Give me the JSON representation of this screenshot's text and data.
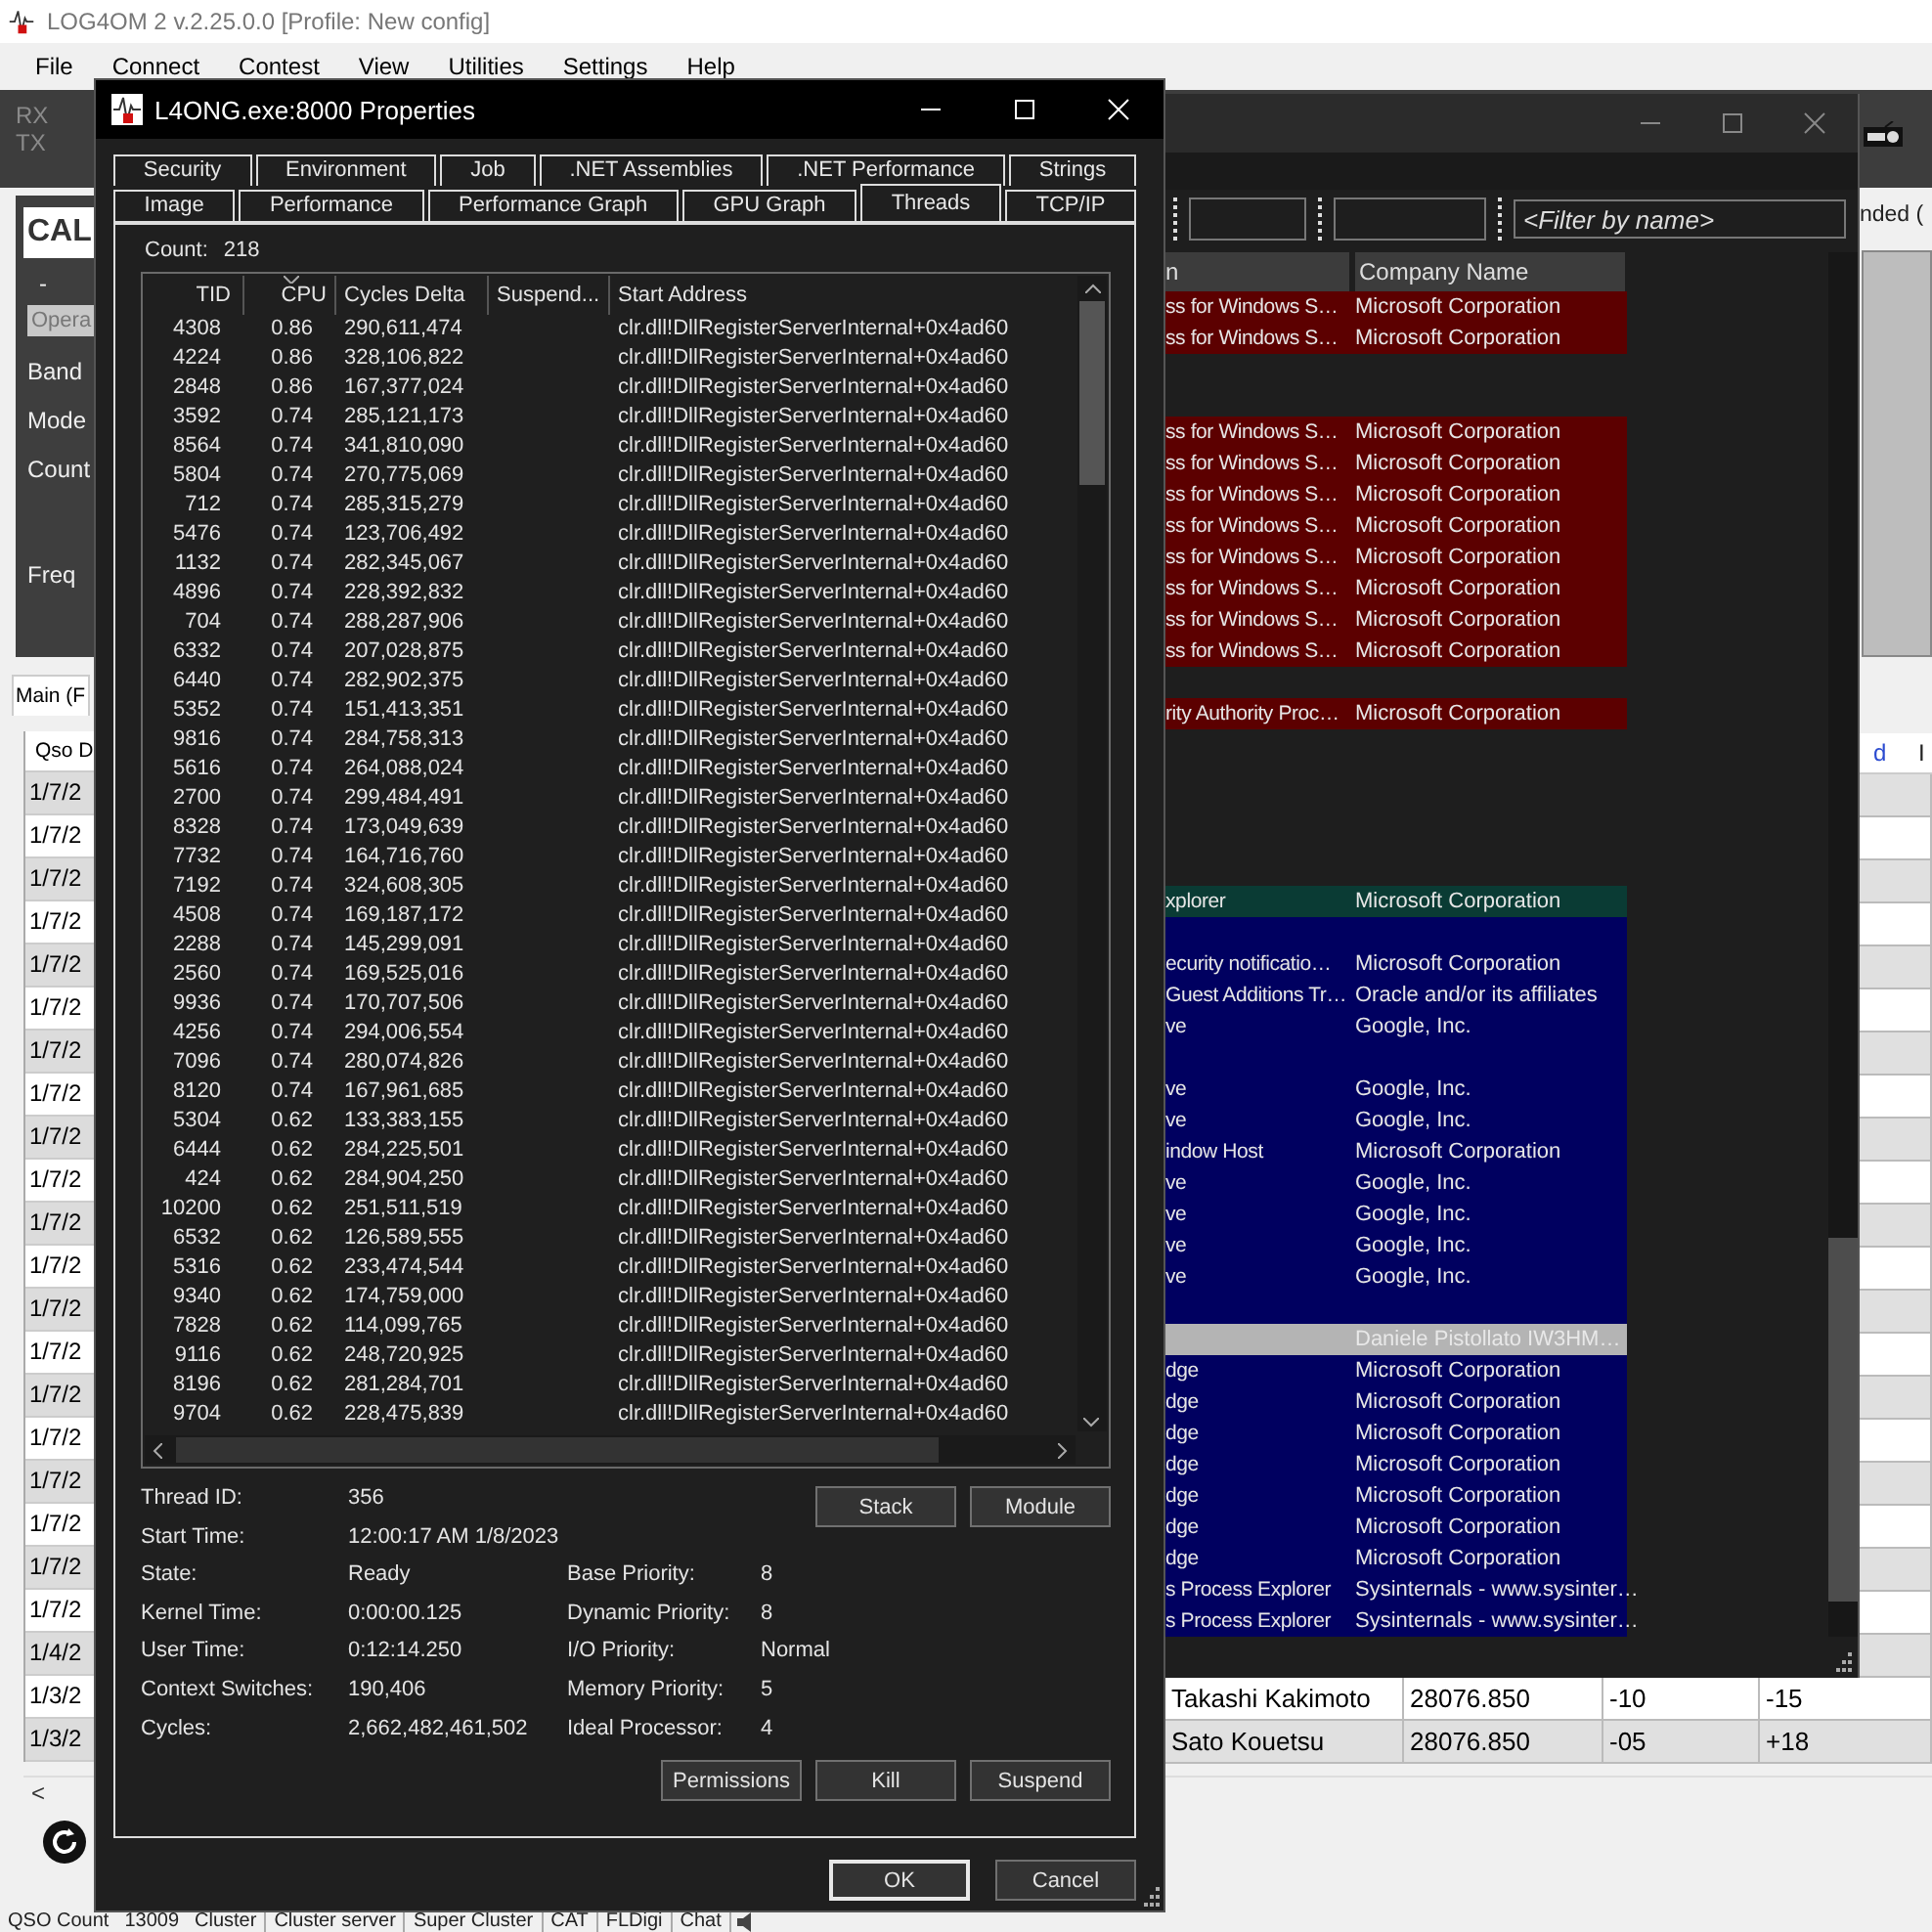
{
  "main_window": {
    "title": "LOG4OM 2 v.2.25.0.0 [Profile: New config]",
    "menu": [
      "File",
      "Connect",
      "Contest",
      "View",
      "Utilities",
      "Settings",
      "Help"
    ],
    "toolbar_labels": [
      "RX",
      "TX"
    ],
    "callsign_label": "CAL",
    "dash": "-",
    "operator_field": "Opera",
    "panel_labels": [
      "Band",
      "Mode",
      "Count"
    ],
    "freq_label": "Freq",
    "tab": "Main (F",
    "filter_text": "nded (",
    "table": {
      "column": "Qso D",
      "right_headers": [
        "d",
        "I"
      ],
      "dates": [
        "1/7/2",
        "1/7/2",
        "1/7/2",
        "1/7/2",
        "1/7/2",
        "1/7/2",
        "1/7/2",
        "1/7/2",
        "1/7/2",
        "1/7/2",
        "1/7/2",
        "1/7/2",
        "1/7/2",
        "1/7/2",
        "1/7/2",
        "1/7/2",
        "1/7/2",
        "1/7/2",
        "1/7/2",
        "1/7/2",
        "1/4/2",
        "1/3/2",
        "1/3/2"
      ],
      "bottom_rows": [
        {
          "name": "Takashi Kakimoto",
          "frequency": "28076.850",
          "column_3": "-10",
          "column_4": "-15"
        },
        {
          "name": "Sato Kouetsu",
          "frequency": "28076.850",
          "column_3": "-05",
          "column_4": "+18"
        }
      ],
      "scroll_left": "<"
    },
    "status_bar": [
      "QSO Count",
      "13009",
      "Cluster",
      "Cluster server",
      "Super Cluster",
      "CAT",
      "FLDigi",
      "Chat"
    ]
  },
  "process_explorer": {
    "filter": {
      "placeholder": "<Filter by name>"
    },
    "columns": [
      "n",
      "Company Name"
    ],
    "rows": [
      {
        "description": "ss for Windows S…",
        "company": "Microsoft Corporation",
        "color": "#5c0000"
      },
      {
        "description": "ss for Windows S…",
        "company": "Microsoft Corporation",
        "color": "#5c0000"
      },
      {
        "color": "#1e1e1e"
      },
      {
        "color": "#1e1e1e"
      },
      {
        "description": "ss for Windows S…",
        "company": "Microsoft Corporation",
        "color": "#5c0000"
      },
      {
        "description": "ss for Windows S…",
        "company": "Microsoft Corporation",
        "color": "#5c0000"
      },
      {
        "description": "ss for Windows S…",
        "company": "Microsoft Corporation",
        "color": "#5c0000"
      },
      {
        "description": "ss for Windows S…",
        "company": "Microsoft Corporation",
        "color": "#5c0000"
      },
      {
        "description": "ss for Windows S…",
        "company": "Microsoft Corporation",
        "color": "#5c0000"
      },
      {
        "description": "ss for Windows S…",
        "company": "Microsoft Corporation",
        "color": "#5c0000"
      },
      {
        "description": "ss for Windows S…",
        "company": "Microsoft Corporation",
        "color": "#5c0000"
      },
      {
        "description": "ss for Windows S…",
        "company": "Microsoft Corporation",
        "color": "#5c0000"
      },
      {
        "color": "#1e1e1e"
      },
      {
        "description": "rity Authority Proc…",
        "company": "Microsoft Corporation",
        "color": "#5c0000"
      },
      {
        "color": "#1e1e1e"
      },
      {
        "color": "#1e1e1e"
      },
      {
        "color": "#1e1e1e"
      },
      {
        "color": "#1e1e1e"
      },
      {
        "color": "#1e1e1e"
      },
      {
        "description": "xplorer",
        "company": "Microsoft Corporation",
        "color": "#0a3b34"
      },
      {
        "color": "#000060"
      },
      {
        "description": "ecurity notificatio…",
        "company": "Microsoft Corporation",
        "color": "#000060"
      },
      {
        "description": "Guest Additions Tr…",
        "company": "Oracle and/or its affiliates",
        "color": "#000060"
      },
      {
        "description": "ve",
        "company": "Google, Inc.",
        "color": "#000060"
      },
      {
        "color": "#000060"
      },
      {
        "description": "ve",
        "company": "Google, Inc.",
        "color": "#000060"
      },
      {
        "description": "ve",
        "company": "Google, Inc.",
        "color": "#000060"
      },
      {
        "description": "indow Host",
        "company": "Microsoft Corporation",
        "color": "#000060"
      },
      {
        "description": "ve",
        "company": "Google, Inc.",
        "color": "#000060"
      },
      {
        "description": "ve",
        "company": "Google, Inc.",
        "color": "#000060"
      },
      {
        "description": "ve",
        "company": "Google, Inc.",
        "color": "#000060"
      },
      {
        "description": "ve",
        "company": "Google, Inc.",
        "color": "#000060"
      },
      {
        "color": "#000060"
      },
      {
        "company": "Daniele Pistollato IW3HM…",
        "color": "#b4b4b4"
      },
      {
        "description": "dge",
        "company": "Microsoft Corporation",
        "color": "#000060"
      },
      {
        "description": "dge",
        "company": "Microsoft Corporation",
        "color": "#000060"
      },
      {
        "description": "dge",
        "company": "Microsoft Corporation",
        "color": "#000060"
      },
      {
        "description": "dge",
        "company": "Microsoft Corporation",
        "color": "#000060"
      },
      {
        "description": "dge",
        "company": "Microsoft Corporation",
        "color": "#000060"
      },
      {
        "description": "dge",
        "company": "Microsoft Corporation",
        "color": "#000060"
      },
      {
        "description": "dge",
        "company": "Microsoft Corporation",
        "color": "#000060"
      },
      {
        "description": "s Process Explorer",
        "company": "Sysinternals - www.sysinter…",
        "color": "#000060"
      },
      {
        "description": "s Process Explorer",
        "company": "Sysinternals - www.sysinter…",
        "color": "#000060"
      }
    ]
  },
  "properties": {
    "title": "L4ONG.exe:8000 Properties",
    "tab_rows": [
      [
        {
          "label": "Security",
          "selected": false
        },
        {
          "label": "Environment",
          "selected": false
        },
        {
          "label": "Job",
          "selected": false
        },
        {
          "label": ".NET Assemblies",
          "selected": false
        },
        {
          "label": ".NET Performance",
          "selected": false
        },
        {
          "label": "Strings",
          "selected": false
        }
      ],
      [
        {
          "label": "Image",
          "selected": false
        },
        {
          "label": "Performance",
          "selected": false
        },
        {
          "label": "Performance Graph",
          "selected": false
        },
        {
          "label": "GPU Graph",
          "selected": false
        },
        {
          "label": "Threads",
          "selected": true
        },
        {
          "label": "TCP/IP",
          "selected": false
        }
      ]
    ],
    "count_label": "Count:",
    "count": "218",
    "columns": [
      "TID",
      "CPU",
      "Cycles Delta",
      "Suspend...",
      "Start Address"
    ],
    "threads": [
      [
        "4308",
        "0.86",
        "290,611,474",
        "clr.dll!DllRegisterServerInternal+0x4ad60"
      ],
      [
        "4224",
        "0.86",
        "328,106,822",
        "clr.dll!DllRegisterServerInternal+0x4ad60"
      ],
      [
        "2848",
        "0.86",
        "167,377,024",
        "clr.dll!DllRegisterServerInternal+0x4ad60"
      ],
      [
        "3592",
        "0.74",
        "285,121,173",
        "clr.dll!DllRegisterServerInternal+0x4ad60"
      ],
      [
        "8564",
        "0.74",
        "341,810,090",
        "clr.dll!DllRegisterServerInternal+0x4ad60"
      ],
      [
        "5804",
        "0.74",
        "270,775,069",
        "clr.dll!DllRegisterServerInternal+0x4ad60"
      ],
      [
        "712",
        "0.74",
        "285,315,279",
        "clr.dll!DllRegisterServerInternal+0x4ad60"
      ],
      [
        "5476",
        "0.74",
        "123,706,492",
        "clr.dll!DllRegisterServerInternal+0x4ad60"
      ],
      [
        "1132",
        "0.74",
        "282,345,067",
        "clr.dll!DllRegisterServerInternal+0x4ad60"
      ],
      [
        "4896",
        "0.74",
        "228,392,832",
        "clr.dll!DllRegisterServerInternal+0x4ad60"
      ],
      [
        "704",
        "0.74",
        "288,287,906",
        "clr.dll!DllRegisterServerInternal+0x4ad60"
      ],
      [
        "6332",
        "0.74",
        "207,028,875",
        "clr.dll!DllRegisterServerInternal+0x4ad60"
      ],
      [
        "6440",
        "0.74",
        "282,902,375",
        "clr.dll!DllRegisterServerInternal+0x4ad60"
      ],
      [
        "5352",
        "0.74",
        "151,413,351",
        "clr.dll!DllRegisterServerInternal+0x4ad60"
      ],
      [
        "9816",
        "0.74",
        "284,758,313",
        "clr.dll!DllRegisterServerInternal+0x4ad60"
      ],
      [
        "5616",
        "0.74",
        "264,088,024",
        "clr.dll!DllRegisterServerInternal+0x4ad60"
      ],
      [
        "2700",
        "0.74",
        "299,484,491",
        "clr.dll!DllRegisterServerInternal+0x4ad60"
      ],
      [
        "8328",
        "0.74",
        "173,049,639",
        "clr.dll!DllRegisterServerInternal+0x4ad60"
      ],
      [
        "7732",
        "0.74",
        "164,716,760",
        "clr.dll!DllRegisterServerInternal+0x4ad60"
      ],
      [
        "7192",
        "0.74",
        "324,608,305",
        "clr.dll!DllRegisterServerInternal+0x4ad60"
      ],
      [
        "4508",
        "0.74",
        "169,187,172",
        "clr.dll!DllRegisterServerInternal+0x4ad60"
      ],
      [
        "2288",
        "0.74",
        "145,299,091",
        "clr.dll!DllRegisterServerInternal+0x4ad60"
      ],
      [
        "2560",
        "0.74",
        "169,525,016",
        "clr.dll!DllRegisterServerInternal+0x4ad60"
      ],
      [
        "9936",
        "0.74",
        "170,707,506",
        "clr.dll!DllRegisterServerInternal+0x4ad60"
      ],
      [
        "4256",
        "0.74",
        "294,006,554",
        "clr.dll!DllRegisterServerInternal+0x4ad60"
      ],
      [
        "7096",
        "0.74",
        "280,074,826",
        "clr.dll!DllRegisterServerInternal+0x4ad60"
      ],
      [
        "8120",
        "0.74",
        "167,961,685",
        "clr.dll!DllRegisterServerInternal+0x4ad60"
      ],
      [
        "5304",
        "0.62",
        "133,383,155",
        "clr.dll!DllRegisterServerInternal+0x4ad60"
      ],
      [
        "6444",
        "0.62",
        "284,225,501",
        "clr.dll!DllRegisterServerInternal+0x4ad60"
      ],
      [
        "424",
        "0.62",
        "284,904,250",
        "clr.dll!DllRegisterServerInternal+0x4ad60"
      ],
      [
        "10200",
        "0.62",
        "251,511,519",
        "clr.dll!DllRegisterServerInternal+0x4ad60"
      ],
      [
        "6532",
        "0.62",
        "126,589,555",
        "clr.dll!DllRegisterServerInternal+0x4ad60"
      ],
      [
        "5316",
        "0.62",
        "233,474,544",
        "clr.dll!DllRegisterServerInternal+0x4ad60"
      ],
      [
        "9340",
        "0.62",
        "174,759,000",
        "clr.dll!DllRegisterServerInternal+0x4ad60"
      ],
      [
        "7828",
        "0.62",
        "114,099,765",
        "clr.dll!DllRegisterServerInternal+0x4ad60"
      ],
      [
        "9116",
        "0.62",
        "248,720,925",
        "clr.dll!DllRegisterServerInternal+0x4ad60"
      ],
      [
        "8196",
        "0.62",
        "281,284,701",
        "clr.dll!DllRegisterServerInternal+0x4ad60"
      ],
      [
        "9704",
        "0.62",
        "228,475,839",
        "clr.dll!DllRegisterServerInternal+0x4ad60"
      ]
    ],
    "detail_top": [
      {
        "label": "Thread ID:",
        "value": "356"
      },
      {
        "label": "Start Time:",
        "value": "12:00:17 AM   1/8/2023"
      }
    ],
    "detail_left": [
      {
        "label": "State:",
        "value": "Ready"
      },
      {
        "label": "Kernel Time:",
        "value": "0:00:00.125"
      },
      {
        "label": "User Time:",
        "value": "0:12:14.250"
      },
      {
        "label": "Context Switches:",
        "value": "190,406"
      },
      {
        "label": "Cycles:",
        "value": "2,662,482,461,502"
      }
    ],
    "detail_right": [
      {
        "label": "Base Priority:",
        "value": "8"
      },
      {
        "label": "Dynamic Priority:",
        "value": "8"
      },
      {
        "label": "I/O Priority:",
        "value": "Normal"
      },
      {
        "label": "Memory Priority:",
        "value": "5"
      },
      {
        "label": "Ideal Processor:",
        "value": "4"
      }
    ],
    "top_buttons": [
      "Stack",
      "Module"
    ],
    "action_buttons": [
      "Permissions",
      "Kill",
      "Suspend"
    ],
    "dialog_buttons": [
      {
        "label": "OK",
        "default": true
      },
      {
        "label": "Cancel",
        "default": false
      }
    ]
  }
}
